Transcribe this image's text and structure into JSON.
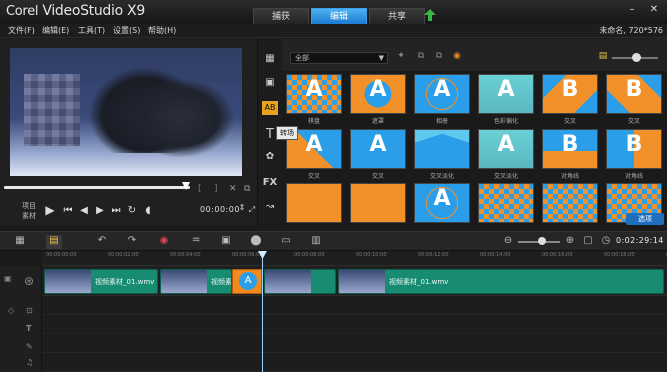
{
  "app": {
    "title": "VideoStudio X9",
    "brand": "Corel"
  },
  "topnav": {
    "capture": "捕获",
    "edit": "编辑",
    "share": "共享"
  },
  "window": {
    "minimize": "–",
    "close": "✕"
  },
  "menu": {
    "file": "文件(F)",
    "edit": "编辑(E)",
    "tools": "工具(T)",
    "settings": "设置(S)",
    "help": "帮助(H)"
  },
  "project_info": "未命名, 720*576",
  "player": {
    "label_project": "项目",
    "label_clip": "素材",
    "timecode": "00:00:00"
  },
  "library": {
    "category": "全部",
    "tooltip": "转场",
    "options_label": "选项",
    "side_fx": "FX",
    "thumbs": [
      {
        "label": "棋盘",
        "glyph": "A",
        "style": "check"
      },
      {
        "label": "遮罩",
        "glyph": "A",
        "style": "orangeA"
      },
      {
        "label": "相册",
        "glyph": "A",
        "style": "blueA"
      },
      {
        "label": "色彩偏化",
        "glyph": "A",
        "style": "fadeA"
      },
      {
        "label": "交叉",
        "glyph": "B",
        "style": "diamond"
      },
      {
        "label": "交叉",
        "glyph": "B",
        "style": "diamond2"
      },
      {
        "label": "交叉",
        "glyph": "A",
        "style": "diag"
      },
      {
        "label": "交叉",
        "glyph": "A",
        "style": "split"
      },
      {
        "label": "交叉淡化",
        "glyph": "",
        "style": "tri"
      },
      {
        "label": "交叉淡化",
        "glyph": "A",
        "style": "fadeA"
      },
      {
        "label": "对角线",
        "glyph": "B",
        "style": "blueB"
      },
      {
        "label": "对角线",
        "glyph": "B",
        "style": "stepB"
      },
      {
        "label": "",
        "glyph": "",
        "style": "orangeB"
      },
      {
        "label": "",
        "glyph": "",
        "style": "orangeB"
      },
      {
        "label": "",
        "glyph": "A",
        "style": "blueA"
      },
      {
        "label": "",
        "glyph": "",
        "style": "check"
      },
      {
        "label": "",
        "glyph": "",
        "style": "check"
      },
      {
        "label": "",
        "glyph": "",
        "style": "check"
      }
    ]
  },
  "timeline": {
    "timecode": "0:02:29:14",
    "ruler": [
      "00:00:00:00",
      "00:00:02:00",
      "00:00:04:00",
      "00:00:06:00",
      "00:00:08:00",
      "00:00:10:00",
      "00:00:12:00",
      "00:00:14:00",
      "00:00:16:00",
      "00:00:18:00",
      "00:00:20:00"
    ],
    "clips": [
      "视频素材_01.wmv",
      "视频素材",
      "视频素材_01.wmv"
    ],
    "transition_glyph": "A"
  }
}
